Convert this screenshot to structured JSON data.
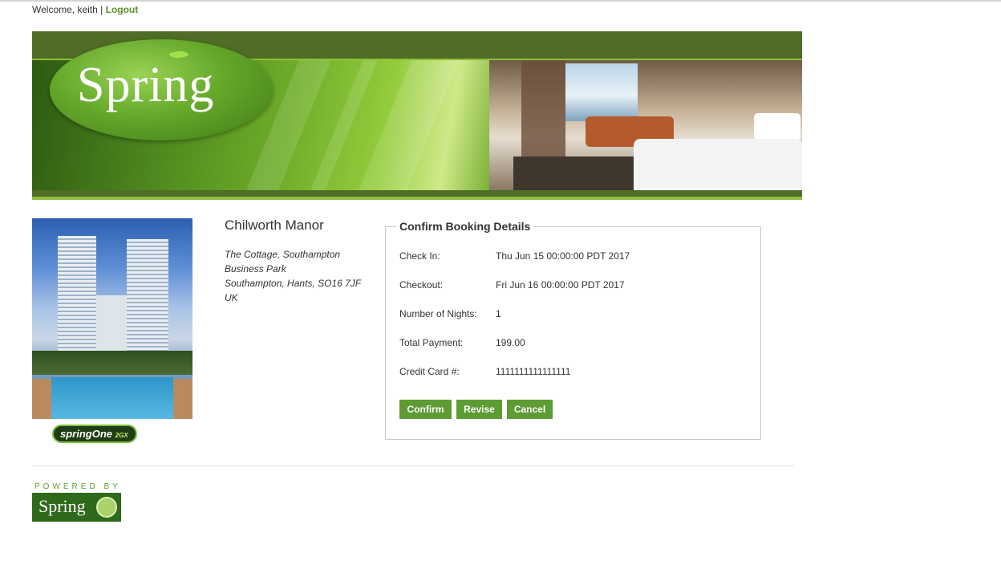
{
  "header": {
    "welcome_text": "Welcome, keith |",
    "logout_label": "Logout"
  },
  "banner": {
    "logo_text": "Spring"
  },
  "hotel": {
    "name": "Chilworth Manor",
    "address_line1": "The Cottage, Southampton",
    "address_line2": "Business Park",
    "address_line3": "Southampton, Hants, SO16 7JF",
    "address_line4": "UK",
    "badge_text": "springOne",
    "badge_suffix": "2GX"
  },
  "booking": {
    "legend": "Confirm Booking Details",
    "rows": [
      {
        "label": "Check In:",
        "value": "Thu Jun 15 00:00:00 PDT 2017"
      },
      {
        "label": "Checkout:",
        "value": "Fri Jun 16 00:00:00 PDT 2017"
      },
      {
        "label": "Number of Nights:",
        "value": "1"
      },
      {
        "label": "Total Payment:",
        "value": "199.00"
      },
      {
        "label": "Credit Card #:",
        "value": "1111111111111111"
      }
    ],
    "confirm_label": "Confirm",
    "revise_label": "Revise",
    "cancel_label": "Cancel"
  },
  "footer": {
    "powered_by": "POWERED BY",
    "logo_text": "Spring"
  },
  "colors": {
    "accent": "#5d9b33",
    "banner_dark": "#4f6d26",
    "banner_light": "#8cbf3a"
  }
}
